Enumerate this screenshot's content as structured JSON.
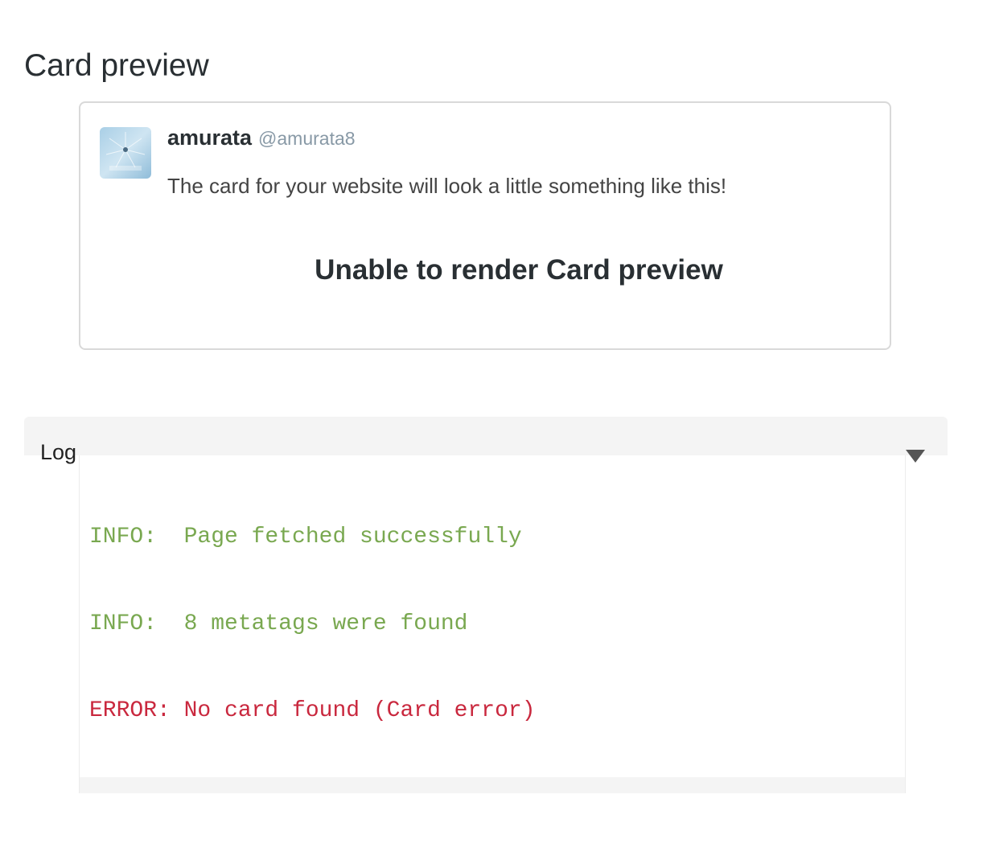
{
  "page": {
    "title": "Card preview"
  },
  "card": {
    "display_name": "amurata",
    "handle": "@amurata8",
    "text": "The card for your website will look a little something like this!",
    "render_message": "Unable to render Card preview",
    "avatar_icon": "profile-photo"
  },
  "log": {
    "label": "Log",
    "toggle_icon": "triangle-down-icon",
    "lines": [
      {
        "level": "info",
        "text": "INFO:  Page fetched successfully"
      },
      {
        "level": "info",
        "text": "INFO:  8 metatags were found"
      },
      {
        "level": "error",
        "text": "ERROR: No card found (Card error)"
      }
    ]
  },
  "colors": {
    "info": "#79a850",
    "error": "#c9283e",
    "handle": "#8899a6"
  }
}
